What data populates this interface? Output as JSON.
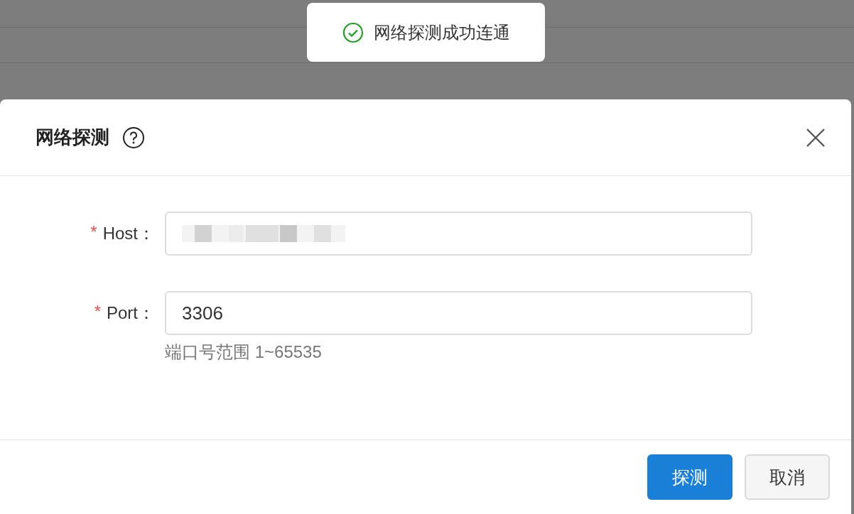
{
  "toast": {
    "text": "网络探测成功连通",
    "kind": "success"
  },
  "dialog": {
    "title": "网络探测",
    "fields": [
      {
        "required_mark": "*",
        "label": "Host：",
        "redacted": true
      },
      {
        "required_mark": "*",
        "label": "Port：",
        "value": "3306",
        "help": "端口号范围 1~65535"
      }
    ],
    "buttons": [
      {
        "label": "探测",
        "kind": "primary"
      },
      {
        "label": "取消",
        "kind": "default"
      }
    ]
  }
}
